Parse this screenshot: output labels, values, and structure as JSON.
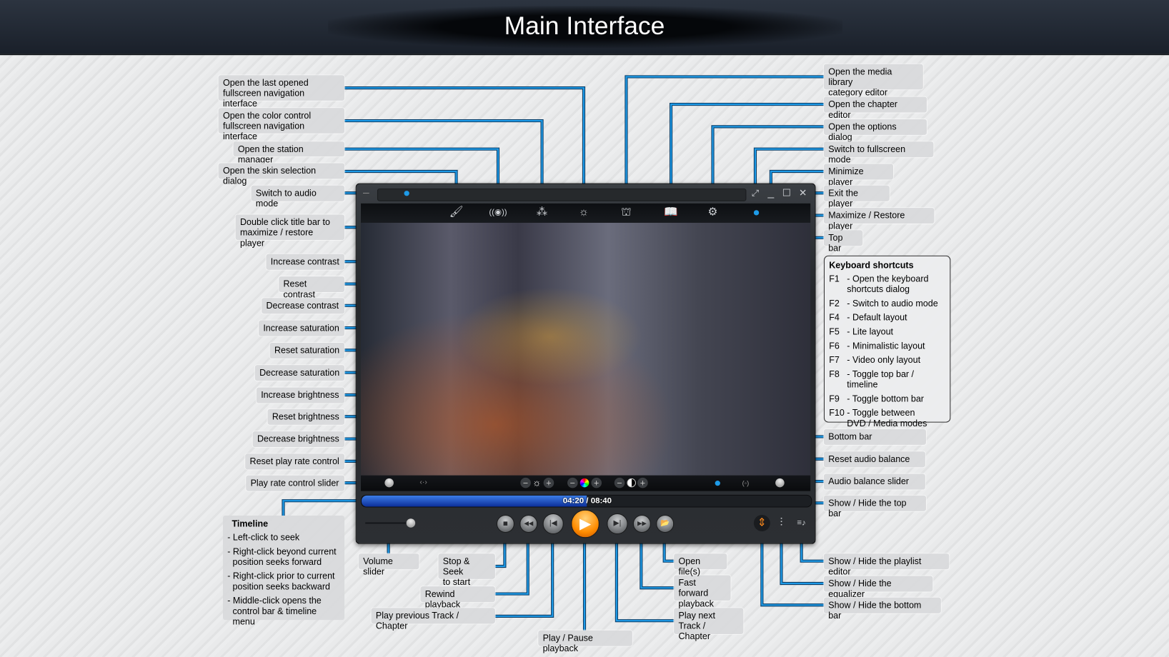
{
  "title": "Main Interface",
  "colors": {
    "connector": "#1e9be8",
    "header": "#1a202a",
    "play_button": "#ff8c00",
    "timeline_fill": "#1d4fc4"
  },
  "left_labels": [
    "Open the last opened\nfullscreen navigation interface",
    "Open the color control\nfullscreen navigation interface",
    "Open the station manager",
    "Open the skin selection dialog",
    "Switch to audio mode",
    "Double click title bar to\nmaximize / restore player",
    "Increase contrast",
    "Reset contrast",
    "Decrease contrast",
    "Increase saturation",
    "Reset saturation",
    "Decrease saturation",
    "Increase brightness",
    "Reset brightness",
    "Decrease brightness",
    "Reset play rate control",
    "Play rate control slider"
  ],
  "right_labels": [
    "Open the media library\ncategory editor",
    "Open the chapter editor",
    "Open the options dialog",
    "Switch to fullscreen mode",
    "Minimize player",
    "Exit the player",
    "Maximize / Restore player",
    "Top bar",
    "Bottom bar",
    "Reset audio balance",
    "Audio balance slider",
    "Show / Hide the top bar",
    "Show / Hide the playlist editor",
    "Show / Hide the equalizer",
    "Show / Hide the bottom bar"
  ],
  "bottom_labels": [
    "Volume slider",
    "Stop & Seek\nto start",
    "Rewind playback",
    "Play previous Track / Chapter",
    "Play / Pause playback",
    "Play next\nTrack / Chapter",
    "Fast forward\nplayback",
    "Open file(s)"
  ],
  "keyboard": {
    "title": "Keyboard shortcuts",
    "items": [
      {
        "key": "F1",
        "desc": "- Open the keyboard\n  shortcuts dialog"
      },
      {
        "key": "F2",
        "desc": "- Switch to audio mode"
      },
      {
        "key": "F4",
        "desc": "- Default layout"
      },
      {
        "key": "F5",
        "desc": "- Lite layout"
      },
      {
        "key": "F6",
        "desc": "- Minimalistic layout"
      },
      {
        "key": "F7",
        "desc": "- Video only layout"
      },
      {
        "key": "F8",
        "desc": "- Toggle top bar / timeline"
      },
      {
        "key": "F9",
        "desc": "- Toggle bottom bar"
      },
      {
        "key": "F10",
        "desc": "- Toggle between\n  DVD / Media modes"
      }
    ]
  },
  "timeline": {
    "title": "Timeline",
    "items": [
      "- Left-click to seek",
      "- Right-click beyond current\nposition seeks forward",
      "- Right-click prior to current\nposition seeks backward",
      "- Middle-click opens the\ncontrol bar & timeline menu"
    ]
  },
  "player": {
    "time": "04:20 / 08:40",
    "progress_percent": 50,
    "top_icons": [
      "brush-icon",
      "station-icon",
      "color-circles-icon",
      "navigation-icon",
      "library-icon",
      "chapter-book-icon",
      "gear-icon"
    ]
  }
}
